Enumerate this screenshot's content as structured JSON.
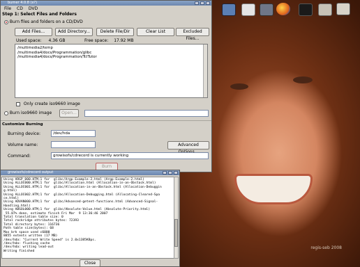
{
  "window": {
    "title": "burner 4.0.8 (x?)"
  },
  "menu": [
    "File",
    "CD",
    "DVD"
  ],
  "step1": {
    "title": "Step 1: Select Files and Folders",
    "burn_option": "Burn files and folders on a CD/DVD",
    "buttons": {
      "add_files": "Add Files...",
      "add_directory": "Add Directory...",
      "delete": "Delete File/Dir",
      "clear": "Clear List",
      "excluded": "Excluded Files..."
    },
    "used_space_label": "Used space:",
    "used_space_value": "4.36 GB",
    "free_space_label": "Free space:",
    "free_space_value": "17.92 MB",
    "files": [
      "/multimedia2/temp",
      "/multimedia4/docs/Programmation/glibc",
      "/multimedia4/docs/Programmation/TclTutor"
    ],
    "iso_only_label": "Only create iso9660 image",
    "iso_burn_option": "Burn iso9660 image",
    "open_button": "Open...",
    "iso_path": ""
  },
  "customize": {
    "title": "Customize Burning",
    "burning_device_label": "Burning device:",
    "burning_device_value": "/dev/hda",
    "volume_name_label": "Volume name:",
    "volume_name_value": "",
    "advanced_button": "Advanced Options...",
    "command_label": "Command:",
    "command_value": "growisofs/cdrecord is currently working",
    "burn_button": "Burn"
  },
  "output": {
    "title": "growisofs/cdrecord output",
    "lines": [
      "Using ARGP_000.HTM;1 for  glibc/Argp-Example-2.html (Argp-Example-2.html)",
      "Using ALLOC000.HTM;1 for  glibc/Allocation.html (Allocation-in-an-Obstack.html)",
      "Using ALLOC001.HTM;1 for  glibc/Allocation-in-an-Obstack.html (Allocation-Debuggin",
      "g.html)",
      "Using ALLOC002.HTM;1 for  glibc/Allocation-Debugging.html (Allocating-Cleared-Spa",
      "ce.html)",
      "Using ADVAN000.HTM;1 for  glibc/Advanced-getent-functions.html (Advanced-Signal-",
      "Handling.html)",
      "Using ABSOL000.HTM;1 for  glibc/Absolute-Value.html (Absolute-Priority.html)",
      " 55.87% done, estimate finish Fri Mar  9 13:36:46 2007",
      "Total translation table size: 0",
      "Total rockridge attributes bytes: 72393",
      "Total directory bytes: 116736",
      "Path table size(bytes): 68",
      "Max brk space used c6000",
      "8855 extents written (17 MB)",
      "/dev/hda: \"Current Write Speed\" is 2.0x1385KBps.",
      "/dev/hda: flushing cache",
      "/dev/hda: writing lead-out",
      "Writing finished"
    ],
    "close_button": "Close"
  },
  "desktop": {
    "icons": [
      "monitor-icon",
      "trash-icon",
      "firefox-icon",
      "mail-icon",
      "terminal-icon",
      "gimp-icon",
      "network-icon"
    ],
    "watermark": "regis-seb 2008"
  }
}
